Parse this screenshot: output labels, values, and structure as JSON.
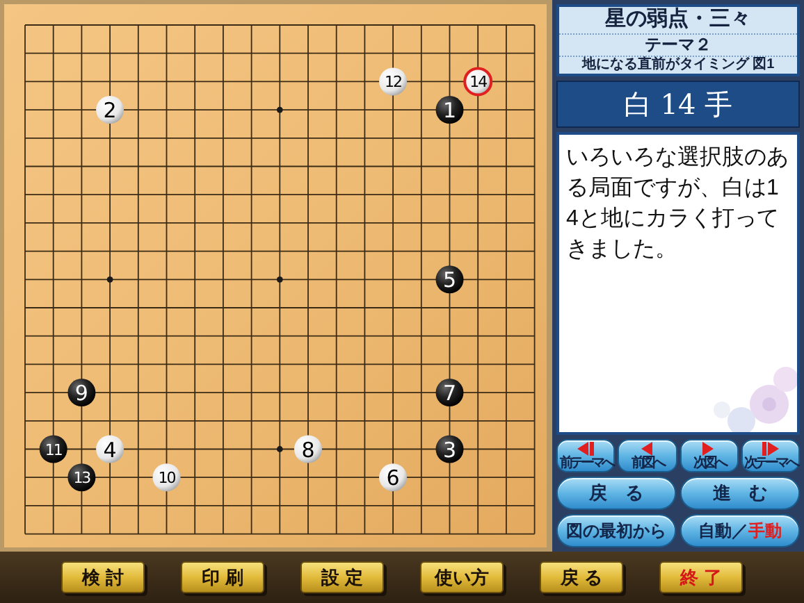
{
  "board": {
    "stones": [
      {
        "number": "12",
        "kind": "white",
        "last": false
      },
      {
        "number": "14",
        "kind": "white",
        "last": true
      },
      {
        "number": "2",
        "kind": "white",
        "last": false
      },
      {
        "number": "1",
        "kind": "black",
        "last": false
      },
      {
        "number": "5",
        "kind": "black",
        "last": false
      },
      {
        "number": "9",
        "kind": "black",
        "last": false
      },
      {
        "number": "7",
        "kind": "black",
        "last": false
      },
      {
        "number": "11",
        "kind": "black",
        "last": false
      },
      {
        "number": "4",
        "kind": "white",
        "last": false
      },
      {
        "number": "8",
        "kind": "white",
        "last": false
      },
      {
        "number": "3",
        "kind": "black",
        "last": false
      },
      {
        "number": "13",
        "kind": "black",
        "last": false
      },
      {
        "number": "10",
        "kind": "white",
        "last": false
      },
      {
        "number": "6",
        "kind": "white",
        "last": false
      }
    ]
  },
  "title_box": {
    "title": "星の弱点・三々",
    "theme": "テーマ２",
    "subtitle": "地になる直前がタイミング 図1"
  },
  "move_label": "白 14 手",
  "comment": "いろいろな選択肢のある局面ですが、白は14と地にカラく打ってきました。",
  "nav_buttons": [
    {
      "label": "前テーマへ",
      "kind": "prev-theme"
    },
    {
      "label": "前図へ",
      "kind": "prev"
    },
    {
      "label": "次図へ",
      "kind": "next"
    },
    {
      "label": "次テーマへ",
      "kind": "next-theme"
    }
  ],
  "step_buttons": [
    "戻　る",
    "進　む"
  ],
  "start_button": "図の最初から",
  "mode_toggle": {
    "separator": "／",
    "options": [
      {
        "label": "自動",
        "selected": false
      },
      {
        "label": "手動",
        "selected": true
      }
    ]
  },
  "bottom_buttons": [
    {
      "label": "検 討",
      "kind": "normal"
    },
    {
      "label": "印 刷",
      "kind": "normal"
    },
    {
      "label": "設 定",
      "kind": "normal"
    },
    {
      "label": "使い方",
      "kind": "normal"
    },
    {
      "label": "戻 る",
      "kind": "normal"
    },
    {
      "label": "終 了",
      "kind": "exit"
    }
  ]
}
